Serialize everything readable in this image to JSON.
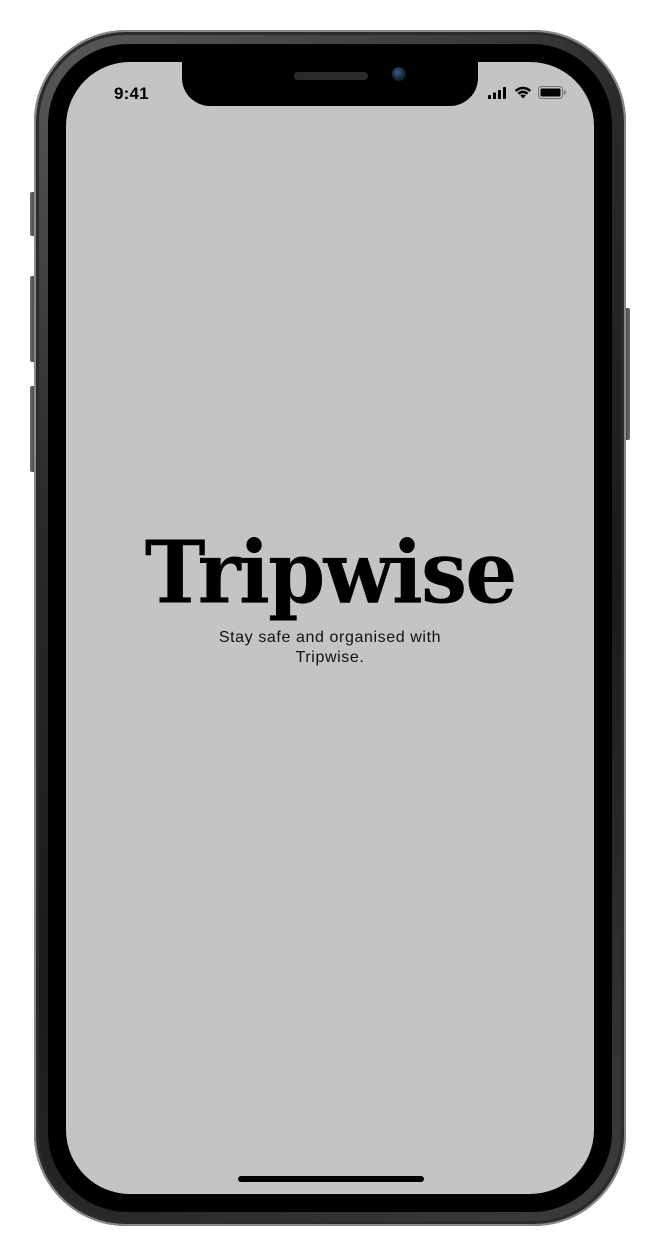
{
  "status_bar": {
    "time": "9:41",
    "icons": [
      "cellular-signal-icon",
      "wifi-icon",
      "battery-icon"
    ]
  },
  "splash": {
    "logo_text": "Tripwise",
    "tagline": "Stay safe and organised with Tripwise."
  },
  "colors": {
    "screen_background": "#c4c4c4",
    "text": "#000000"
  }
}
